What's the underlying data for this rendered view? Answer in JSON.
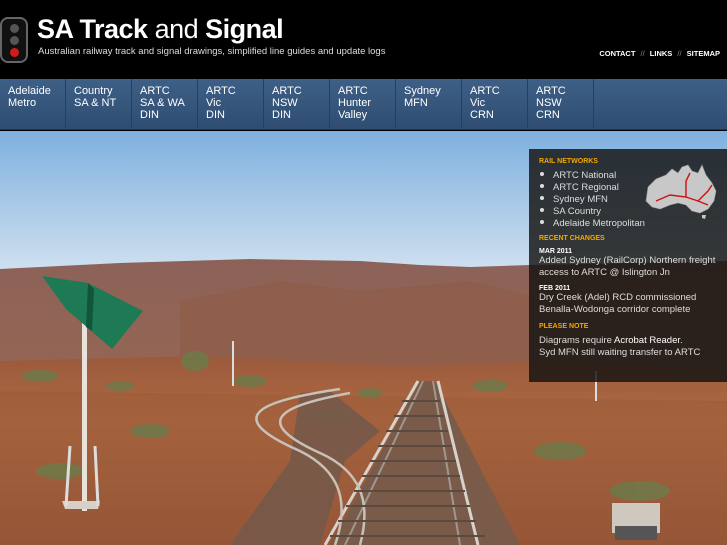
{
  "header": {
    "title_bold": "SA Track",
    "title_mid": " and ",
    "title_end": "Signal",
    "tagline": "Australian railway track and signal drawings, simplified line guides and update logs",
    "links": [
      "CONTACT",
      "LINKS",
      "SITEMAP"
    ],
    "link_separator": "//"
  },
  "nav": {
    "items": [
      {
        "label": "Adelaide\nMetro"
      },
      {
        "label": "Country\nSA & NT"
      },
      {
        "label": "ARTC\nSA & WA\nDIN"
      },
      {
        "label": "ARTC\nVic\nDIN"
      },
      {
        "label": "ARTC\nNSW\nDIN"
      },
      {
        "label": "ARTC\nHunter\nValley"
      },
      {
        "label": "Sydney\nMFN"
      },
      {
        "label": "ARTC\nVic\nCRN"
      },
      {
        "label": "ARTC\nNSW\nCRN"
      }
    ]
  },
  "panel": {
    "networks_heading": "RAIL NETWORKS",
    "networks": [
      "ARTC National",
      "ARTC Regional",
      "Sydney MFN",
      "SA Country",
      "Adelaide Metropolitan"
    ],
    "changes_heading": "RECENT CHANGES",
    "changes": [
      {
        "date": "MAR 2011",
        "text": "Added Sydney (RailCorp) Northern freight access to ARTC @ Islington Jn"
      },
      {
        "date": "FEB 2011",
        "text": "Dry Creek (Adel) RCD commissioned Benalla-Wodonga corridor complete"
      }
    ],
    "note_heading": "PLEASE NOTE",
    "note_prefix": "Diagrams require ",
    "note_link": "Acrobat Reader",
    "note_suffix": ".\nSyd MFN still waiting transfer to ARTC"
  },
  "colors": {
    "accent": "#f2a800",
    "nav_bg": "#34547a",
    "signal_red": "#d21b1b",
    "sign_green": "#1e7a55"
  },
  "icons": {
    "logo": "traffic-signal-icon",
    "map": "australia-map-icon"
  }
}
